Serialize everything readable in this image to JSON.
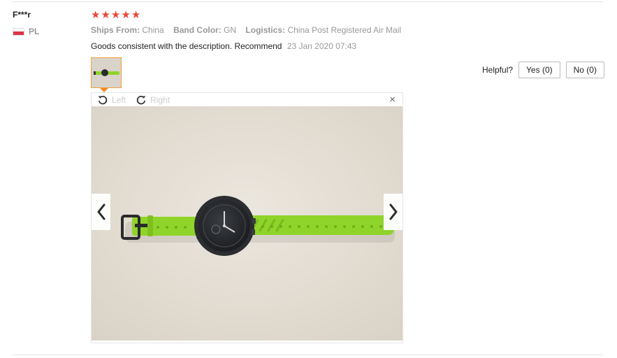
{
  "user": {
    "name": "F***r",
    "country_code": "PL"
  },
  "rating": {
    "stars": 5,
    "max": 5
  },
  "attributes": [
    {
      "key": "Ships From:",
      "value": "China"
    },
    {
      "key": "Band Color:",
      "value": "GN"
    },
    {
      "key": "Logistics:",
      "value": "China Post Registered Air Mail"
    }
  ],
  "review": {
    "text": "Goods consistent with the description. Recommend",
    "date": "23 Jan 2020 07:43"
  },
  "helpful": {
    "label": "Helpful?",
    "yes": "Yes (0)",
    "no": "No (0)"
  },
  "viewer": {
    "rotate_left": "Left",
    "rotate_right": "Right",
    "close": "×"
  },
  "colors": {
    "star": "#e9473a",
    "thumb_border": "#f0a040",
    "band": "#8fd42a"
  }
}
